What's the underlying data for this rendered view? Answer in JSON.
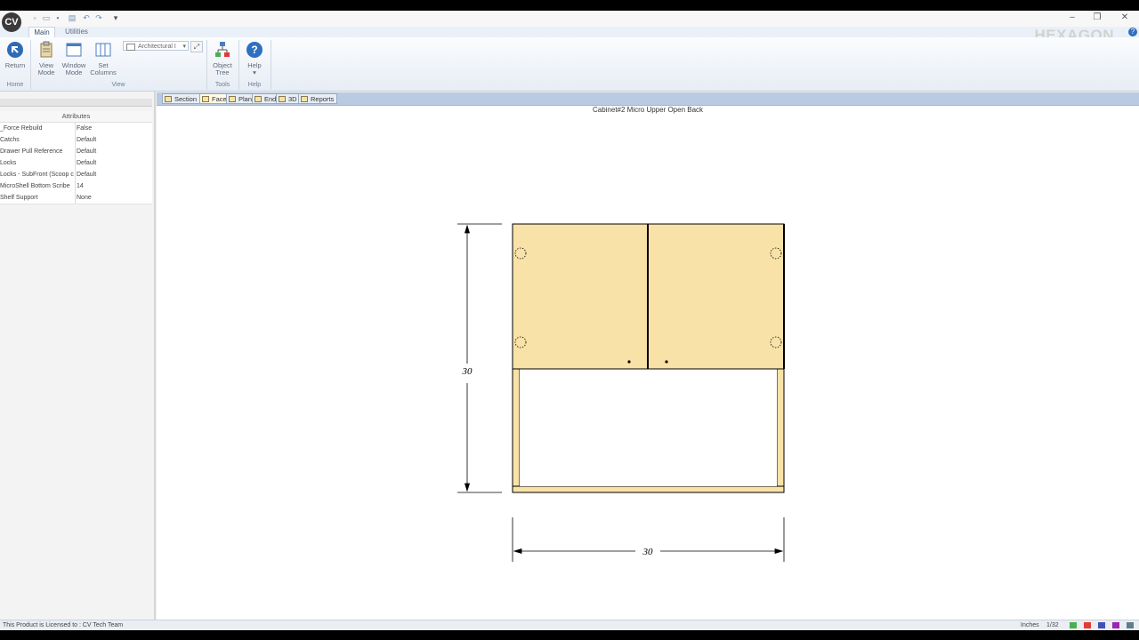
{
  "app": {
    "logo_text": "CV"
  },
  "ribbon": {
    "tabs": [
      {
        "label": "Main",
        "active": true
      },
      {
        "label": "Utilities",
        "active": false
      }
    ],
    "buttons": {
      "return": "Return",
      "view_mode_1": "View",
      "view_mode_2": "Mode",
      "window_mode_1": "Window",
      "window_mode_2": "Mode",
      "set_columns_1": "Set",
      "set_columns_2": "Columns",
      "units_dropdown": "Architectural I",
      "object_tree_1": "Object",
      "object_tree_2": "Tree",
      "help": "Help"
    },
    "groups": {
      "home": "Home",
      "view": "View",
      "tools": "Tools",
      "help": "Help"
    },
    "brand": "HEXAGON",
    "colors": {
      "accent": "#2f6fc0"
    }
  },
  "attributes": {
    "title": "Attributes",
    "rows": [
      {
        "key": "_Force Rebuild",
        "value": "False"
      },
      {
        "key": "Catchs",
        "value": "Default"
      },
      {
        "key": "Drawer Pull Reference",
        "value": "Default"
      },
      {
        "key": "Locks",
        "value": "Default"
      },
      {
        "key": "Locks - SubFront (Scoop c",
        "value": "Default"
      },
      {
        "key": "MicroShell Bottom Scribe",
        "value": "14"
      },
      {
        "key": "Shelf Support",
        "value": "None"
      }
    ]
  },
  "view_tabs": [
    {
      "label": "Section",
      "active": false
    },
    {
      "label": "Face",
      "active": true
    },
    {
      "label": "Plan",
      "active": false
    },
    {
      "label": "End",
      "active": false
    },
    {
      "label": "3D",
      "active": false
    },
    {
      "label": "Reports",
      "active": false
    }
  ],
  "drawing": {
    "title": "Cabinet#2 Micro Upper Open Back",
    "height_dim": "30",
    "width_dim": "30",
    "colors": {
      "door_fill": "#f8e2a8",
      "frame_fill": "#f8e2a8",
      "line": "#000000"
    }
  },
  "status": {
    "license": "This Product is Licensed to : CV Tech Team",
    "units": "Inches",
    "precision": "1/32"
  }
}
